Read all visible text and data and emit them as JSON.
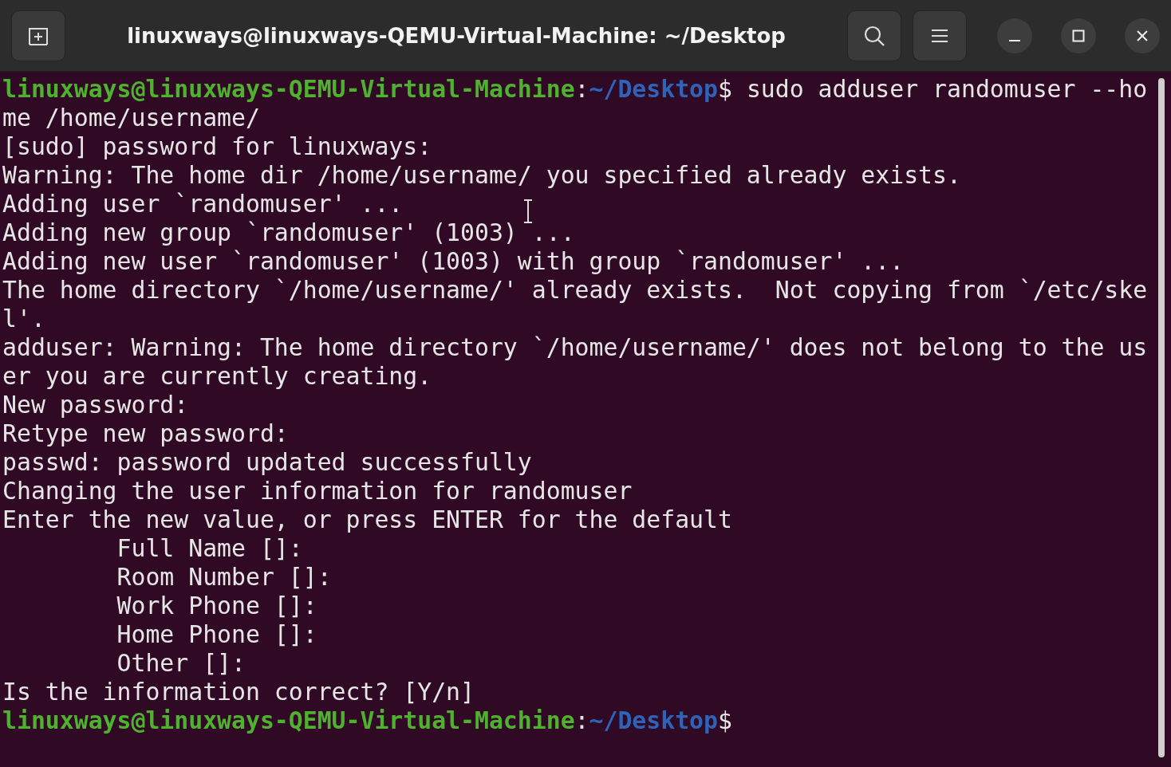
{
  "window": {
    "title": "linuxways@linuxways-QEMU-Virtual-Machine: ~/Desktop"
  },
  "terminal": {
    "rows": [
      {
        "kind": "prompt",
        "segments": [
          {
            "kind": "user",
            "text": "linuxways@linuxways-QEMU-Virtual-Machine"
          },
          {
            "kind": "plain",
            "text": ":"
          },
          {
            "kind": "path",
            "text": "~/Desktop"
          },
          {
            "kind": "plain",
            "text": "$ sudo adduser randomuser --ho"
          }
        ]
      },
      {
        "kind": "output",
        "text": "me /home/username/"
      },
      {
        "kind": "output",
        "text": "[sudo] password for linuxways:"
      },
      {
        "kind": "output",
        "text": "Warning: The home dir /home/username/ you specified already exists."
      },
      {
        "kind": "output",
        "text": "Adding user `randomuser' ..."
      },
      {
        "kind": "output",
        "text": "Adding new group `randomuser' (1003) ..."
      },
      {
        "kind": "output",
        "text": "Adding new user `randomuser' (1003) with group `randomuser' ..."
      },
      {
        "kind": "output",
        "text": "The home directory `/home/username/' already exists.  Not copying from `/etc/ske"
      },
      {
        "kind": "output",
        "text": "l'."
      },
      {
        "kind": "output",
        "text": "adduser: Warning: The home directory `/home/username/' does not belong to the us"
      },
      {
        "kind": "output",
        "text": "er you are currently creating."
      },
      {
        "kind": "output",
        "text": "New password:"
      },
      {
        "kind": "output",
        "text": "Retype new password:"
      },
      {
        "kind": "output",
        "text": "passwd: password updated successfully"
      },
      {
        "kind": "output",
        "text": "Changing the user information for randomuser"
      },
      {
        "kind": "output",
        "text": "Enter the new value, or press ENTER for the default"
      },
      {
        "kind": "output",
        "text": "        Full Name []:"
      },
      {
        "kind": "output",
        "text": "        Room Number []:"
      },
      {
        "kind": "output",
        "text": "        Work Phone []:"
      },
      {
        "kind": "output",
        "text": "        Home Phone []:"
      },
      {
        "kind": "output",
        "text": "        Other []:"
      },
      {
        "kind": "output",
        "text": "Is the information correct? [Y/n]"
      },
      {
        "kind": "prompt",
        "segments": [
          {
            "kind": "user",
            "text": "linuxways@linuxways-QEMU-Virtual-Machine"
          },
          {
            "kind": "plain",
            "text": ":"
          },
          {
            "kind": "path",
            "text": "~/Desktop"
          },
          {
            "kind": "plain",
            "text": "$"
          }
        ]
      }
    ]
  }
}
